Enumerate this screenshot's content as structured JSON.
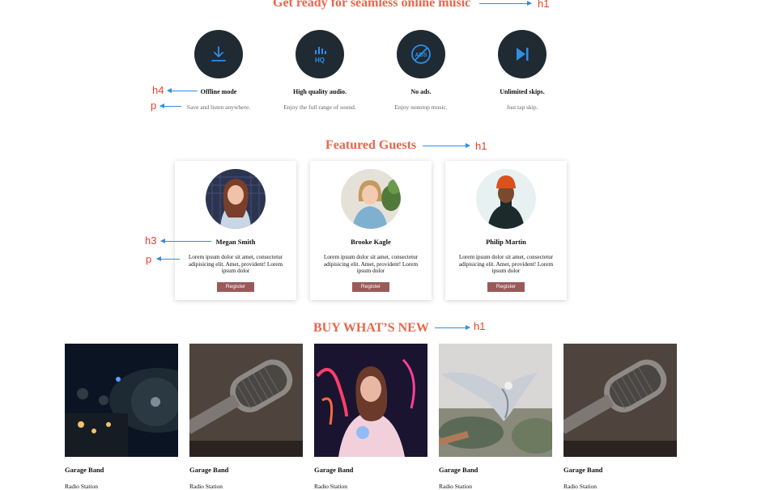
{
  "sections": {
    "features_heading": "Get ready for seamless online music",
    "guests_heading": "Featured Guests",
    "shop_heading": "BUY WHAT’S NEW"
  },
  "annotations": {
    "h1_a": "h1",
    "h4": "h4",
    "p_a": "p",
    "h1_b": "h1",
    "h3": "h3",
    "p_b": "p",
    "h1_c": "h1"
  },
  "features": [
    {
      "title": "Offline mode",
      "desc": "Save and listen anywhere.",
      "icon": "download-icon"
    },
    {
      "title": "High quality audio.",
      "desc": "Enjoy the full range of sound.",
      "icon": "hq-audio-icon"
    },
    {
      "title": "No ads.",
      "desc": "Enjoy nonstop music.",
      "icon": "no-ads-icon"
    },
    {
      "title": "Unlimited skips.",
      "desc": "Just tap skip.",
      "icon": "skip-icon"
    }
  ],
  "icon_labels": {
    "hq": "HQ",
    "ads": "ADS"
  },
  "guests": [
    {
      "name": "Megan Smith",
      "desc": "Lorem ipsum dolor sit amet, consectetur adipisicing elit. Amet, provident! Lorem ipsum dolor",
      "button": "Register"
    },
    {
      "name": "Brooke Kagle",
      "desc": "Lorem ipsum dolor sit amet, consectetur adipisicing elit. Amet, provident! Lorem ipsum dolor",
      "button": "Register"
    },
    {
      "name": "Philip Martin",
      "desc": "Lorem ipsum dolor sit amet, consectetur adipisicing elit. Amet, provident! Lorem ipsum dolor",
      "button": "Register"
    }
  ],
  "products": [
    {
      "title": "Garage Band",
      "subtitle": "Radio Station"
    },
    {
      "title": "Garage Band",
      "subtitle": "Radio Station"
    },
    {
      "title": "Garage Band",
      "subtitle": "Radio Station"
    },
    {
      "title": "Garage Band",
      "subtitle": "Radio Station"
    },
    {
      "title": "Garage Band",
      "subtitle": "Radio Station"
    }
  ],
  "colors": {
    "accent": "#e8664a",
    "icon_bg": "#202a33",
    "icon_blue": "#2f8fe8",
    "button": "#9a5a5a",
    "annotation": "#e8412a"
  }
}
